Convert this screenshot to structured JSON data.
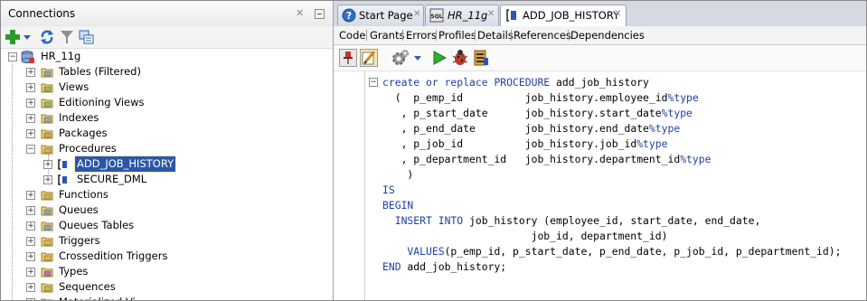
{
  "connections_panel": {
    "title": "Connections",
    "close_glyph": "✕",
    "toolbar_icons": [
      "add-icon",
      "dropdown-arrow-icon",
      "refresh-icon",
      "filter-icon",
      "schema-browser-icon"
    ],
    "tree": {
      "root": "HR_11g",
      "nodes": [
        {
          "label": "Tables (Filtered)",
          "icon": "tables-icon"
        },
        {
          "label": "Views",
          "icon": "views-icon"
        },
        {
          "label": "Editioning Views",
          "icon": "editioning-views-icon"
        },
        {
          "label": "Indexes",
          "icon": "indexes-icon"
        },
        {
          "label": "Packages",
          "icon": "packages-icon"
        },
        {
          "label": "Procedures",
          "icon": "procedures-icon"
        },
        {
          "label": "ADD_JOB_HISTORY",
          "icon": "procedure-icon",
          "selected": true
        },
        {
          "label": "SECURE_DML",
          "icon": "procedure-icon"
        },
        {
          "label": "Functions",
          "icon": "functions-icon"
        },
        {
          "label": "Queues",
          "icon": "queues-icon"
        },
        {
          "label": "Queues Tables",
          "icon": "queues-tables-icon"
        },
        {
          "label": "Triggers",
          "icon": "triggers-icon"
        },
        {
          "label": "Crossedition Triggers",
          "icon": "crossedition-triggers-icon"
        },
        {
          "label": "Types",
          "icon": "types-icon"
        },
        {
          "label": "Sequences",
          "icon": "sequences-icon"
        },
        {
          "label": "Materialized Vi...",
          "icon": "materialized-views-icon"
        }
      ]
    }
  },
  "editor_tabs": [
    {
      "label": "Start Page",
      "icon": "help-icon"
    },
    {
      "label": "HR_11g",
      "icon": "sql-worksheet-icon"
    },
    {
      "label": "ADD_JOB_HISTORY",
      "icon": "procedure-icon",
      "active": true
    }
  ],
  "tab_close_glyph": "✕",
  "sub_tabs": [
    "Code",
    "Grants",
    "Errors",
    "Profiles",
    "Details",
    "References",
    "Dependencies"
  ],
  "active_sub_tab": "Code",
  "code_toolbar_icons": [
    "pin-icon",
    "edit-icon",
    "gear-icon",
    "dropdown-arrow-icon",
    "run-icon",
    "debug-icon",
    "compile-icon"
  ],
  "fold_glyph": "−",
  "code": {
    "l1_kw": "create or replace PROCEDURE",
    "l1_name": " add_job_history",
    "params": [
      {
        "prefix": "  (  ",
        "name": "p_emp_id          ",
        "ref": "job_history.employee_id",
        "type": "%type"
      },
      {
        "prefix": "   , ",
        "name": "p_start_date      ",
        "ref": "job_history.start_date",
        "type": "%type"
      },
      {
        "prefix": "   , ",
        "name": "p_end_date        ",
        "ref": "job_history.end_date",
        "type": "%type"
      },
      {
        "prefix": "   , ",
        "name": "p_job_id          ",
        "ref": "job_history.job_id",
        "type": "%type"
      },
      {
        "prefix": "   , ",
        "name": "p_department_id   ",
        "ref": "job_history.department_id",
        "type": "%type"
      }
    ],
    "close_paren": "    )",
    "is": "IS",
    "begin": "BEGIN",
    "insert_kw": "  INSERT INTO",
    "insert_rest": " job_history (employee_id, start_date, end_date,",
    "insert_cont": "                        job_id, department_id)",
    "values_kw": "    VALUES",
    "values_rest": "(p_emp_id, p_start_date, p_end_date, p_job_id, p_department_id);",
    "end_kw": "END",
    "end_rest": " add_job_history;"
  }
}
